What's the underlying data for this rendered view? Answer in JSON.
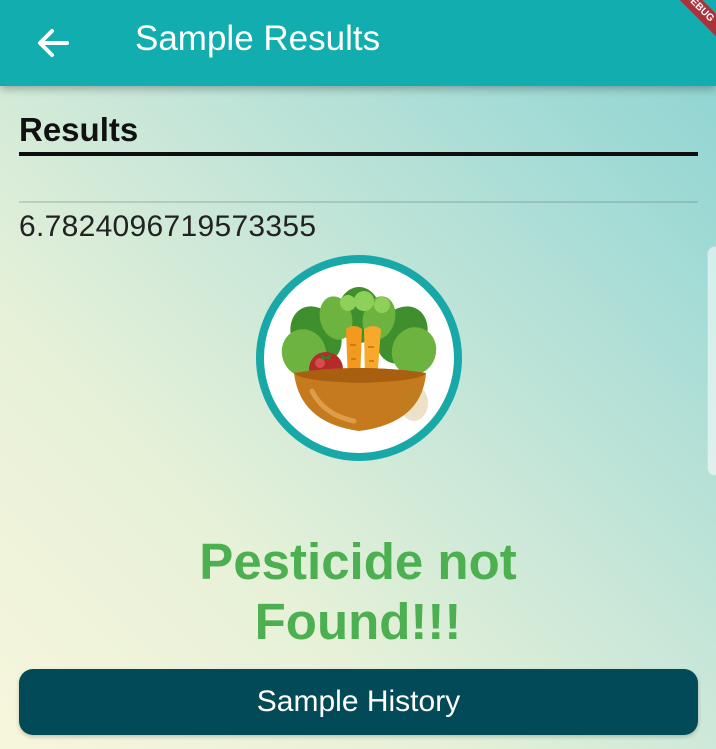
{
  "app_bar": {
    "title": "Sample Results",
    "back_icon": "arrow-left-icon",
    "background": "#12adae",
    "debug_banner": "DEBUG"
  },
  "results": {
    "heading": "Results",
    "value": "6.7824096719573355"
  },
  "illustration": {
    "icon": "vegetable-bowl-icon",
    "ring_color": "#17a8a7"
  },
  "status": {
    "text": "Pesticide not Found!!!",
    "color": "#4caf50"
  },
  "history_button": {
    "label": "Sample History",
    "background": "#024a57"
  }
}
